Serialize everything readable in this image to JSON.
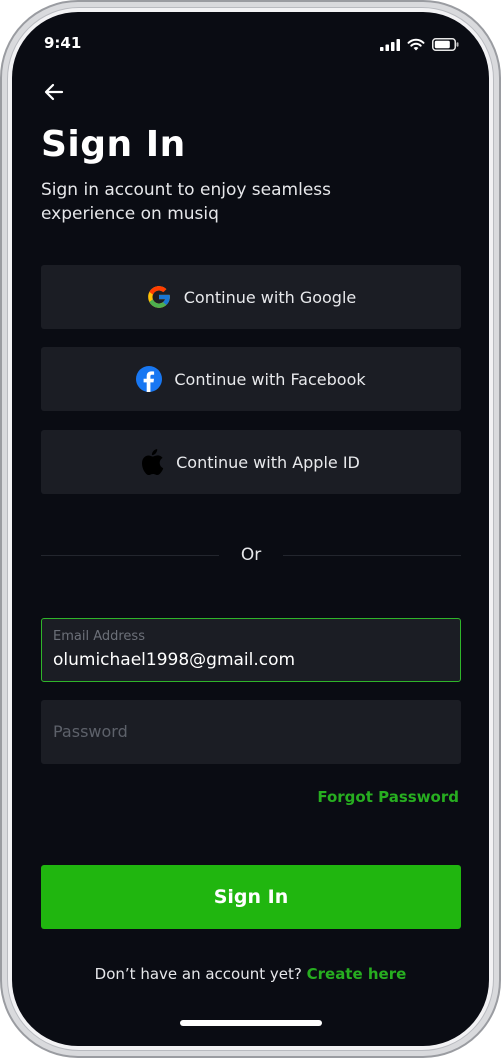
{
  "status_bar": {
    "time": "9:41"
  },
  "header": {
    "title": "Sign In",
    "subtitle": "Sign in account to enjoy seamless experience on musiq"
  },
  "social": {
    "google_label": "Continue with Google",
    "facebook_label": "Continue with Facebook",
    "apple_label": "Continue with Apple ID"
  },
  "divider": {
    "text": "Or"
  },
  "form": {
    "email_label": "Email Address",
    "email_value": "olumichael1998@gmail.com",
    "password_placeholder": "Password",
    "forgot_label": "Forgot Password",
    "submit_label": "Sign In"
  },
  "footer": {
    "prompt": "Don’t have an account yet? ",
    "link_label": "Create here"
  },
  "colors": {
    "background": "#0a0c13",
    "surface": "#1b1d24",
    "accent": "#20b60f",
    "link": "#27ae20"
  },
  "icons": [
    "back-arrow-icon",
    "google-icon",
    "facebook-icon",
    "apple-icon",
    "signal-icon",
    "wifi-icon",
    "battery-icon"
  ]
}
